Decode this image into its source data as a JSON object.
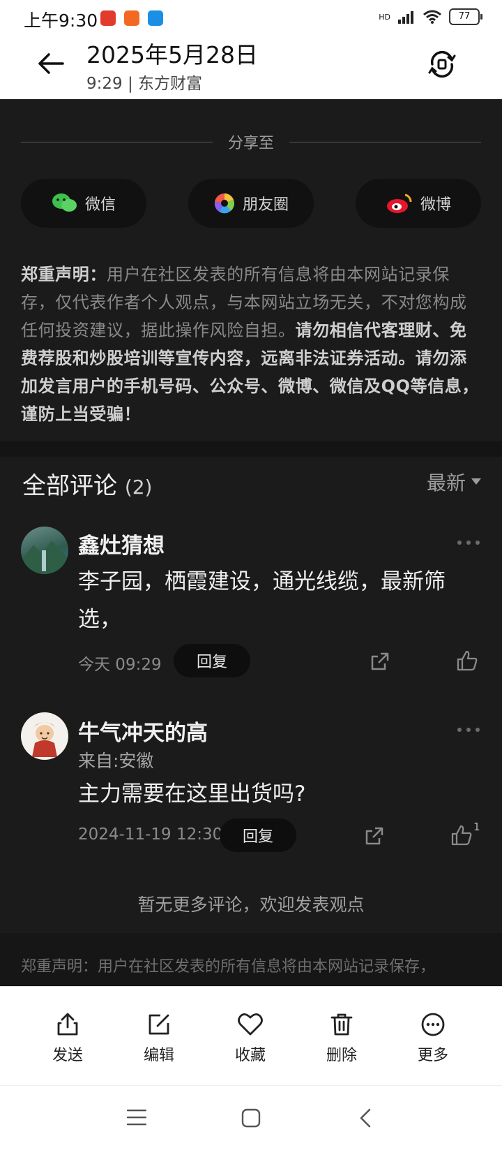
{
  "status_bar": {
    "time": "上午9:30",
    "battery": "77",
    "network": "HD"
  },
  "header": {
    "title": "2025年5月28日",
    "subtitle": "9:29 | 东方财富"
  },
  "share": {
    "heading": "分享至",
    "buttons": [
      {
        "label": "微信"
      },
      {
        "label": "朋友圈"
      },
      {
        "label": "微博"
      }
    ]
  },
  "disclaimer": {
    "label": "郑重声明：",
    "normal": "用户在社区发表的所有信息将由本网站记录保存，仅代表作者个人观点，与本网站立场无关，不对您构成任何投资建议，据此操作风险自担。",
    "bold": "请勿相信代客理财、免费荐股和炒股培训等宣传内容，远离非法证券活动。请勿添加发言用户的手机号码、公众号、微博、微信及QQ等信息，谨防上当受骗！"
  },
  "comments": {
    "title": "全部评论",
    "count": "(2)",
    "sort_label": "最新",
    "items": [
      {
        "user": "鑫灶猜想",
        "from": "",
        "text": "李子园，栖霞建设，通光线缆，最新筛选，",
        "time": "今天 09:29",
        "reply": "回复",
        "likes": ""
      },
      {
        "user": "牛气冲天的高",
        "from": "来自:安徽",
        "text": "主力需要在这里出货吗?",
        "time": "2024-11-19 12:30",
        "reply": "回复",
        "likes": "1"
      }
    ],
    "no_more": "暂无更多评论，欢迎发表观点"
  },
  "footer": {
    "text": "郑重声明：用户在社区发表的所有信息将由本网站记录保存，"
  },
  "action_sheet": {
    "items": [
      {
        "label": "发送",
        "icon": "share-upload-icon"
      },
      {
        "label": "编辑",
        "icon": "edit-icon"
      },
      {
        "label": "收藏",
        "icon": "heart-icon"
      },
      {
        "label": "删除",
        "icon": "trash-icon"
      },
      {
        "label": "更多",
        "icon": "more-circle-icon"
      }
    ]
  },
  "colors": {
    "background": "#1b1b1b",
    "sheet": "#ffffff",
    "text_primary": "#efefef",
    "text_muted": "#8a8a8a"
  }
}
